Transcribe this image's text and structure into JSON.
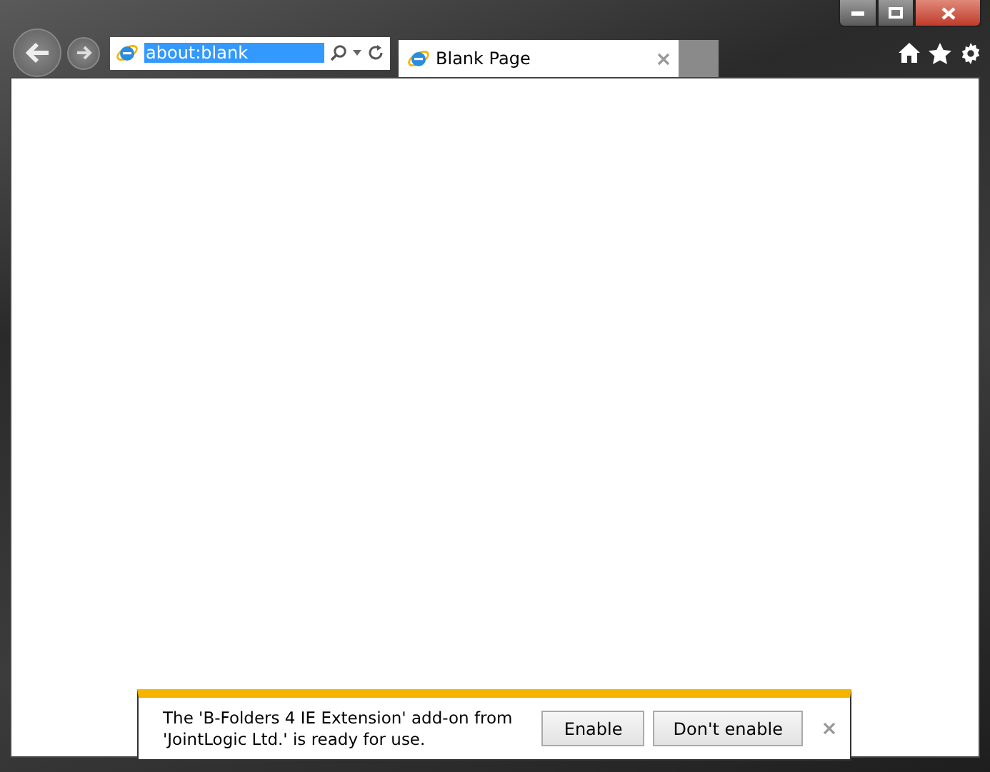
{
  "address_bar": {
    "value": "about:blank",
    "highlighted": true
  },
  "tabs": [
    {
      "label": "Blank Page",
      "selected": true
    }
  ],
  "notification": {
    "message": "The 'B-Folders 4 IE Extension' add-on from 'JointLogic Ltd.' is ready for use.",
    "buttons": [
      "Enable",
      "Don't enable"
    ]
  }
}
